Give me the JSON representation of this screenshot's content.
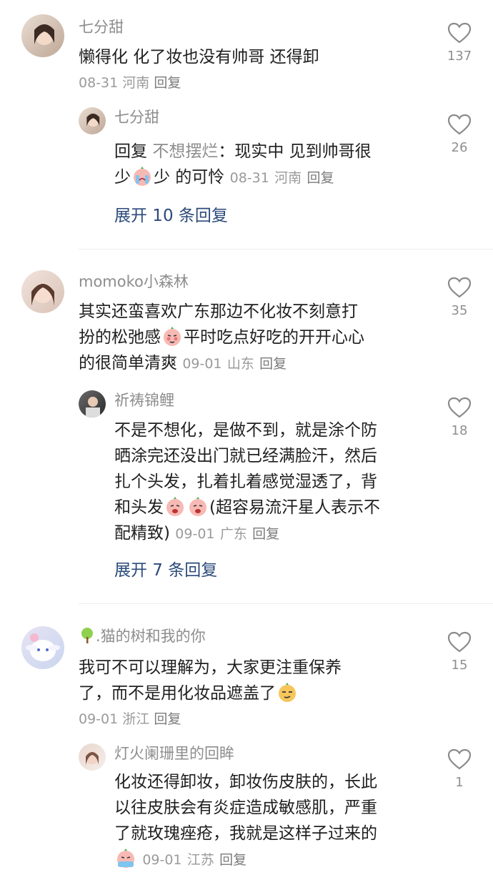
{
  "comments": [
    {
      "name": "七分甜",
      "text": "懒得化 化了妆也没有帅哥 还得卸",
      "date": "08-31",
      "region": "河南",
      "reply_label": "回复",
      "likes": "137",
      "replies": [
        {
          "name": "七分甜",
          "reply_to": "不想摆烂",
          "text_a": "：现实中 见到帅哥很",
          "text_b_pre": "少",
          "text_b_post": "少 的可怜",
          "date": "08-31",
          "region": "河南",
          "reply_label": "回复",
          "likes": "26",
          "reply_prefix": "回复"
        }
      ],
      "expand_label": "展开 10 条回复"
    },
    {
      "name": "momoko小森林",
      "text_l1": "其实还蛮喜欢广东那边不化妆不刻意打",
      "text_l2a": "扮的松弛感",
      "text_l2b": "平时吃点好吃的开开心心",
      "text_l3": "的很简单清爽",
      "date": "09-01",
      "region": "山东",
      "reply_label": "回复",
      "likes": "35",
      "replies": [
        {
          "name": "祈祷锦鲤",
          "l1": "不是不想化，是做不到，就是涂个防",
          "l2": "晒涂完还没出门就已经满脸汗，然后",
          "l3": "扎个头发，扎着扎着感觉湿透了，背",
          "l4a": "和头发",
          "l4b": "(超容易流汗星人表示不",
          "l5": "配精致)",
          "date": "09-01",
          "region": "广东",
          "reply_label": "回复",
          "likes": "18"
        }
      ],
      "expand_label": "展开 7 条回复"
    },
    {
      "name": ".猫的树和我的你",
      "l1": "我可不可以理解为，大家更注重保养",
      "l2": "了，而不是用化妆品遮盖了",
      "date": "09-01",
      "region": "浙江",
      "reply_label": "回复",
      "likes": "15",
      "replies": [
        {
          "name": "灯火阑珊里的回眸",
          "l1": "化妆还得卸妆，卸妆伤皮肤的，长此",
          "l2": "以往皮肤会有炎症造成敏感肌，严重",
          "l3": "了就玫瑰痤疮，我就是这样子过来的",
          "date": "09-01",
          "region": "江苏",
          "reply_label": "回复",
          "likes": "1"
        }
      ]
    }
  ],
  "icons": {
    "like": "heart-outline-icon",
    "emoji_sad": "crying-emoji-icon",
    "emoji_shy": "shy-emoji-icon",
    "emoji_sweat": "sweat-emoji-icon",
    "emoji_cool": "smug-emoji-icon",
    "tree": "tree-icon"
  }
}
